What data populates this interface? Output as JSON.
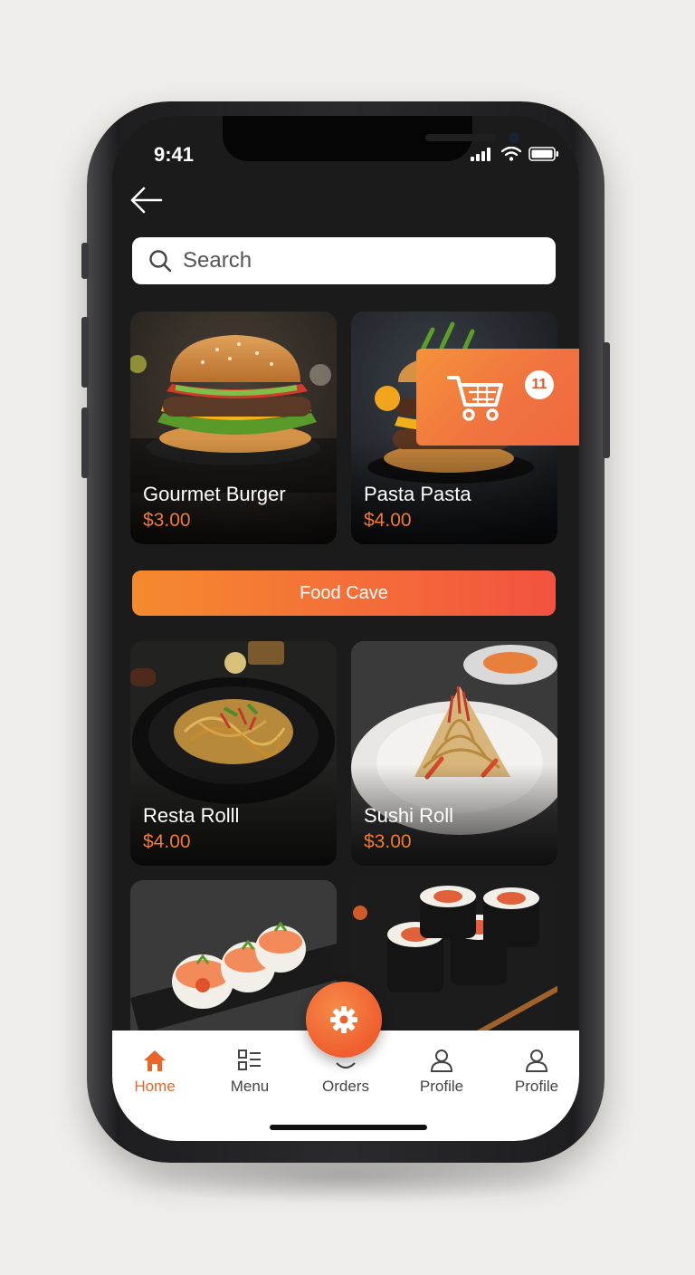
{
  "status_bar": {
    "time": "9:41"
  },
  "search": {
    "placeholder": "Search"
  },
  "cart": {
    "badge_count": "11"
  },
  "products": [
    {
      "name": "Gourmet Burger",
      "price": "$3.00"
    },
    {
      "name": "Pasta Pasta",
      "price": "$4.00"
    },
    {
      "name": "Resta Rolll",
      "price": "$4.00"
    },
    {
      "name": "Sushi Roll",
      "price": "$3.00"
    }
  ],
  "banner": {
    "label": "Food Cave"
  },
  "tabbar": {
    "items": [
      {
        "label": "Home",
        "icon": "home-icon",
        "active": true
      },
      {
        "label": "Menu",
        "icon": "menu-icon"
      },
      {
        "label": "Orders",
        "icon": "orders-icon"
      },
      {
        "label": "Profile",
        "icon": "profile-icon"
      },
      {
        "label": "Profile",
        "icon": "profile-icon"
      }
    ]
  },
  "colors": {
    "accent": "#ef6a2e",
    "price": "#f07a34",
    "screen_bg": "#1b1b1b"
  }
}
